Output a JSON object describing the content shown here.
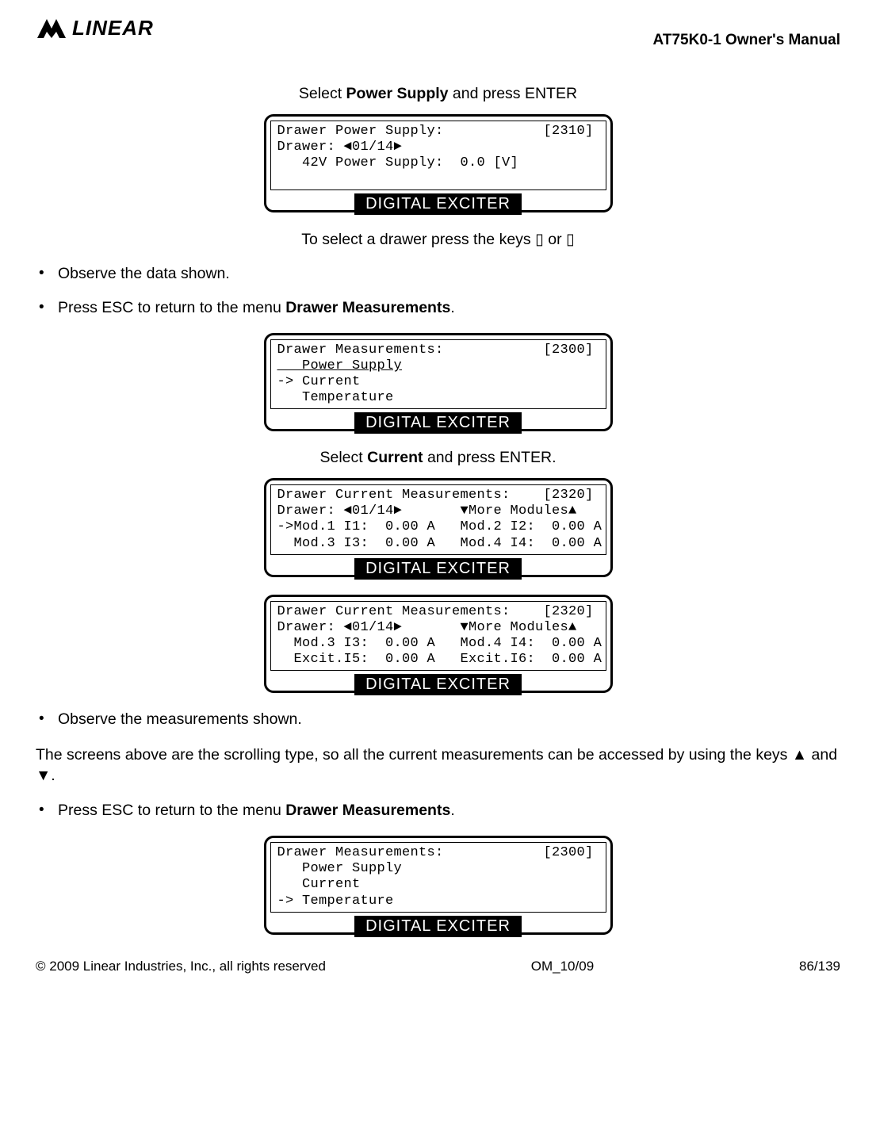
{
  "header": {
    "logo_text": "LINEAR",
    "doc_title": "AT75K0-1 Owner's Manual"
  },
  "section1": {
    "intro_pre": "Select ",
    "intro_bold": "Power Supply",
    "intro_post": " and press ENTER"
  },
  "lcd1": {
    "line1": "Drawer Power Supply:            [2310]",
    "line2": "Drawer: ◄01/14►",
    "line3": "   42V Power Supply:  0.0 [V]",
    "line4": " ",
    "label": "DIGITAL EXCITER"
  },
  "section2": {
    "text": "To select a drawer press the keys ▯ or ▯"
  },
  "bullets1": {
    "b1": "Observe the data shown.",
    "b2_pre": "Press ESC to return to the menu ",
    "b2_bold": "Drawer Measurements",
    "b2_post": "."
  },
  "lcd2": {
    "line1": "Drawer Measurements:            [2300]",
    "line2": "   Power Supply",
    "line3": "-> Current",
    "line4": "   Temperature",
    "label": "DIGITAL EXCITER"
  },
  "section3": {
    "pre": "Select ",
    "bold": "Current",
    "post": " and press ENTER."
  },
  "lcd3": {
    "line1": "Drawer Current Measurements:    [2320]",
    "line2": "Drawer: ◄01/14►       ▼More Modules▲",
    "line3": "->Mod.1 I1:  0.00 A   Mod.2 I2:  0.00 A",
    "line4": "  Mod.3 I3:  0.00 A   Mod.4 I4:  0.00 A",
    "label": "DIGITAL EXCITER"
  },
  "lcd4": {
    "line1": "Drawer Current Measurements:    [2320]",
    "line2": "Drawer: ◄01/14►       ▼More Modules▲",
    "line3": "  Mod.3 I3:  0.00 A   Mod.4 I4:  0.00 A",
    "line4": "  Excit.I5:  0.00 A   Excit.I6:  0.00 A",
    "label": "DIGITAL EXCITER"
  },
  "bullets2": {
    "b1": "Observe the measurements shown."
  },
  "para1": "The screens above are the scrolling type, so all the current measurements can be accessed  by using the keys ▲ and ▼.",
  "bullets3": {
    "b1_pre": "Press ESC to return to the menu ",
    "b1_bold": "Drawer Measurements",
    "b1_post": "."
  },
  "lcd5": {
    "line1": "Drawer Measurements:            [2300]",
    "line2": "   Power Supply",
    "line3": "   Current",
    "line4": "-> Temperature",
    "label": "DIGITAL EXCITER"
  },
  "footer": {
    "left": "© 2009 Linear Industries, Inc., all rights reserved",
    "center": "OM_10/09",
    "right": "86/139"
  }
}
